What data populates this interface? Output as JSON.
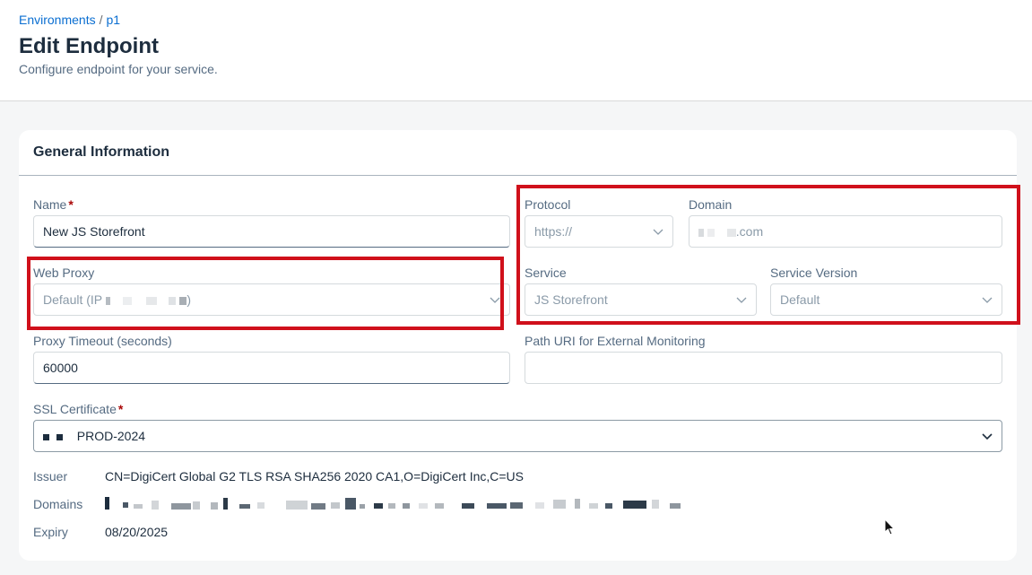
{
  "breadcrumb": {
    "root": "Environments",
    "separator": "/",
    "current": "p1"
  },
  "page": {
    "title": "Edit Endpoint",
    "subtitle": "Configure endpoint for your service."
  },
  "card": {
    "title": "General Information"
  },
  "fields": {
    "name": {
      "label": "Name",
      "required_mark": "*",
      "value": "New JS Storefront"
    },
    "web_proxy": {
      "label": "Web Proxy",
      "value_prefix": "Default (IP",
      "value_suffix": ")"
    },
    "protocol": {
      "label": "Protocol",
      "value": "https://"
    },
    "domain": {
      "label": "Domain",
      "value_suffix": ".com"
    },
    "service": {
      "label": "Service",
      "value": "JS Storefront"
    },
    "service_version": {
      "label": "Service Version",
      "value": "Default"
    },
    "proxy_timeout": {
      "label": "Proxy Timeout (seconds)",
      "value": "60000"
    },
    "path_uri": {
      "label": "Path URI for External Monitoring",
      "value": ""
    },
    "ssl_certificate": {
      "label": "SSL Certificate",
      "required_mark": "*",
      "value": "PROD-2024"
    }
  },
  "certificate": {
    "issuer_label": "Issuer",
    "issuer_value": "CN=DigiCert Global G2 TLS RSA SHA256 2020 CA1,O=DigiCert Inc,C=US",
    "domains_label": "Domains",
    "expiry_label": "Expiry",
    "expiry_value": "08/20/2025"
  },
  "colors": {
    "link": "#0a6ed1",
    "highlight": "#d0101b",
    "required": "#aa0808"
  },
  "icons": {
    "dropdown": "chevron-down-icon",
    "cursor": "mouse-pointer-icon"
  }
}
